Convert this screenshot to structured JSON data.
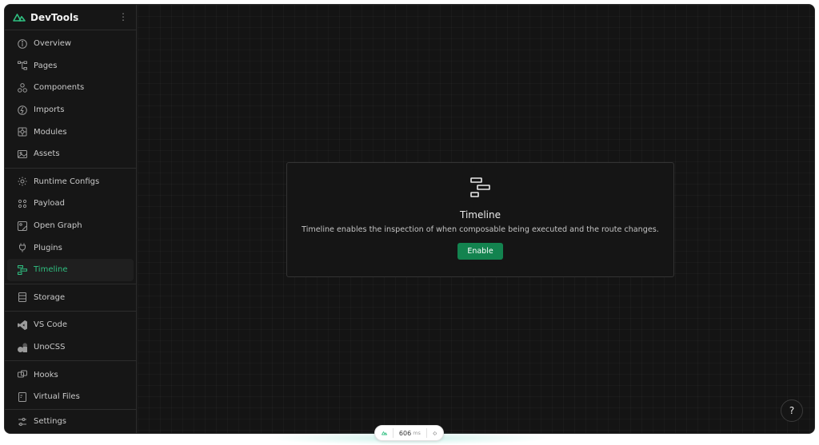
{
  "app": {
    "title": "DevTools",
    "accent": "#2fbf80"
  },
  "sidebar": {
    "groups": [
      [
        {
          "label": "Overview",
          "icon": "info-icon"
        },
        {
          "label": "Pages",
          "icon": "tree-icon"
        },
        {
          "label": "Components",
          "icon": "components-icon"
        },
        {
          "label": "Imports",
          "icon": "lightning-icon"
        },
        {
          "label": "Modules",
          "icon": "modules-icon"
        },
        {
          "label": "Assets",
          "icon": "image-icon"
        }
      ],
      [
        {
          "label": "Runtime Configs",
          "icon": "gear-icon"
        },
        {
          "label": "Payload",
          "icon": "payload-icon"
        },
        {
          "label": "Open Graph",
          "icon": "open-graph-icon"
        },
        {
          "label": "Plugins",
          "icon": "plug-icon"
        },
        {
          "label": "Timeline",
          "icon": "timeline-icon",
          "active": true
        }
      ],
      [
        {
          "label": "Storage",
          "icon": "storage-icon"
        }
      ],
      [
        {
          "label": "VS Code",
          "icon": "vscode-icon"
        },
        {
          "label": "UnoCSS",
          "icon": "unocss-icon"
        }
      ],
      [
        {
          "label": "Hooks",
          "icon": "hooks-icon"
        },
        {
          "label": "Virtual Files",
          "icon": "file-icon"
        }
      ]
    ],
    "settings_label": "Settings"
  },
  "main": {
    "card": {
      "title": "Timeline",
      "description": "Timeline enables the inspection of when composable being executed and the route changes.",
      "button_label": "Enable"
    },
    "help_label": "?"
  },
  "bottom_pill": {
    "value": "606",
    "unit": "ms"
  }
}
